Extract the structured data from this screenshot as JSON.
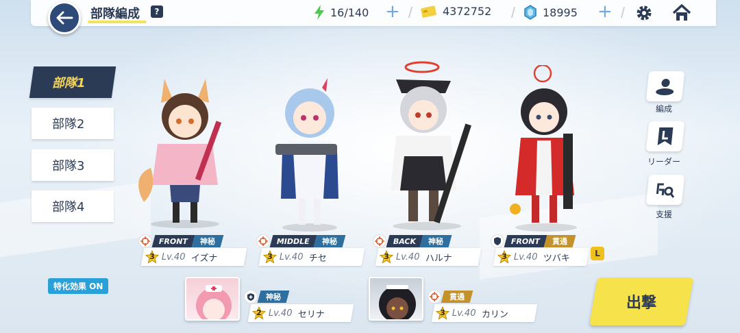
{
  "header": {
    "title": "部隊編成",
    "help": "?",
    "ap": "16/140",
    "credits": "4372752",
    "gems": "18995"
  },
  "squads": [
    "部隊1",
    "部隊2",
    "部隊3",
    "部隊4"
  ],
  "side_buttons": {
    "formation": "編成",
    "leader": "リーダー",
    "support": "支援"
  },
  "characters": [
    {
      "position": "FRONT",
      "attr": "神秘",
      "stars": "3",
      "level": "Lv.40",
      "name": "イズナ"
    },
    {
      "position": "MIDDLE",
      "attr": "神秘",
      "stars": "3",
      "level": "Lv.40",
      "name": "チセ"
    },
    {
      "position": "BACK",
      "attr": "神秘",
      "stars": "3",
      "level": "Lv.40",
      "name": "ハルナ"
    },
    {
      "position": "FRONT",
      "attr": "貫通",
      "stars": "3",
      "level": "Lv.40",
      "name": "ツバキ",
      "leader": "L"
    }
  ],
  "specials": [
    {
      "attr": "神秘",
      "stars": "2",
      "level": "Lv.40",
      "name": "セリナ"
    },
    {
      "attr": "貫通",
      "stars": "3",
      "level": "Lv.40",
      "name": "カリン"
    }
  ],
  "effect_badge": "特化効果 ON",
  "sortie_label": "出撃",
  "colors": {
    "navy": "#2b3b55",
    "accent_yellow": "#f6e24a",
    "mystic": "#2f6f9f",
    "pierce": "#c4922a",
    "effect": "#2aa0d8"
  }
}
